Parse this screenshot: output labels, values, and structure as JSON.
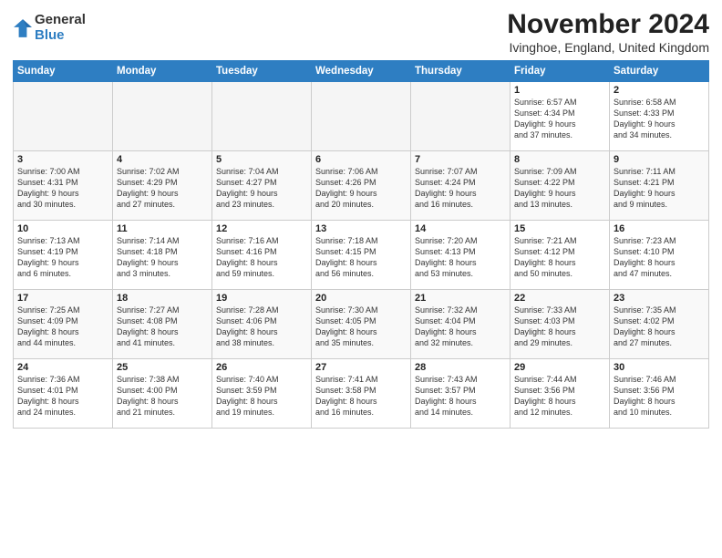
{
  "header": {
    "logo_general": "General",
    "logo_blue": "Blue",
    "month_title": "November 2024",
    "location": "Ivinghoe, England, United Kingdom"
  },
  "days_of_week": [
    "Sunday",
    "Monday",
    "Tuesday",
    "Wednesday",
    "Thursday",
    "Friday",
    "Saturday"
  ],
  "weeks": [
    [
      {
        "day": "",
        "info": ""
      },
      {
        "day": "",
        "info": ""
      },
      {
        "day": "",
        "info": ""
      },
      {
        "day": "",
        "info": ""
      },
      {
        "day": "",
        "info": ""
      },
      {
        "day": "1",
        "info": "Sunrise: 6:57 AM\nSunset: 4:34 PM\nDaylight: 9 hours\nand 37 minutes."
      },
      {
        "day": "2",
        "info": "Sunrise: 6:58 AM\nSunset: 4:33 PM\nDaylight: 9 hours\nand 34 minutes."
      }
    ],
    [
      {
        "day": "3",
        "info": "Sunrise: 7:00 AM\nSunset: 4:31 PM\nDaylight: 9 hours\nand 30 minutes."
      },
      {
        "day": "4",
        "info": "Sunrise: 7:02 AM\nSunset: 4:29 PM\nDaylight: 9 hours\nand 27 minutes."
      },
      {
        "day": "5",
        "info": "Sunrise: 7:04 AM\nSunset: 4:27 PM\nDaylight: 9 hours\nand 23 minutes."
      },
      {
        "day": "6",
        "info": "Sunrise: 7:06 AM\nSunset: 4:26 PM\nDaylight: 9 hours\nand 20 minutes."
      },
      {
        "day": "7",
        "info": "Sunrise: 7:07 AM\nSunset: 4:24 PM\nDaylight: 9 hours\nand 16 minutes."
      },
      {
        "day": "8",
        "info": "Sunrise: 7:09 AM\nSunset: 4:22 PM\nDaylight: 9 hours\nand 13 minutes."
      },
      {
        "day": "9",
        "info": "Sunrise: 7:11 AM\nSunset: 4:21 PM\nDaylight: 9 hours\nand 9 minutes."
      }
    ],
    [
      {
        "day": "10",
        "info": "Sunrise: 7:13 AM\nSunset: 4:19 PM\nDaylight: 9 hours\nand 6 minutes."
      },
      {
        "day": "11",
        "info": "Sunrise: 7:14 AM\nSunset: 4:18 PM\nDaylight: 9 hours\nand 3 minutes."
      },
      {
        "day": "12",
        "info": "Sunrise: 7:16 AM\nSunset: 4:16 PM\nDaylight: 8 hours\nand 59 minutes."
      },
      {
        "day": "13",
        "info": "Sunrise: 7:18 AM\nSunset: 4:15 PM\nDaylight: 8 hours\nand 56 minutes."
      },
      {
        "day": "14",
        "info": "Sunrise: 7:20 AM\nSunset: 4:13 PM\nDaylight: 8 hours\nand 53 minutes."
      },
      {
        "day": "15",
        "info": "Sunrise: 7:21 AM\nSunset: 4:12 PM\nDaylight: 8 hours\nand 50 minutes."
      },
      {
        "day": "16",
        "info": "Sunrise: 7:23 AM\nSunset: 4:10 PM\nDaylight: 8 hours\nand 47 minutes."
      }
    ],
    [
      {
        "day": "17",
        "info": "Sunrise: 7:25 AM\nSunset: 4:09 PM\nDaylight: 8 hours\nand 44 minutes."
      },
      {
        "day": "18",
        "info": "Sunrise: 7:27 AM\nSunset: 4:08 PM\nDaylight: 8 hours\nand 41 minutes."
      },
      {
        "day": "19",
        "info": "Sunrise: 7:28 AM\nSunset: 4:06 PM\nDaylight: 8 hours\nand 38 minutes."
      },
      {
        "day": "20",
        "info": "Sunrise: 7:30 AM\nSunset: 4:05 PM\nDaylight: 8 hours\nand 35 minutes."
      },
      {
        "day": "21",
        "info": "Sunrise: 7:32 AM\nSunset: 4:04 PM\nDaylight: 8 hours\nand 32 minutes."
      },
      {
        "day": "22",
        "info": "Sunrise: 7:33 AM\nSunset: 4:03 PM\nDaylight: 8 hours\nand 29 minutes."
      },
      {
        "day": "23",
        "info": "Sunrise: 7:35 AM\nSunset: 4:02 PM\nDaylight: 8 hours\nand 27 minutes."
      }
    ],
    [
      {
        "day": "24",
        "info": "Sunrise: 7:36 AM\nSunset: 4:01 PM\nDaylight: 8 hours\nand 24 minutes."
      },
      {
        "day": "25",
        "info": "Sunrise: 7:38 AM\nSunset: 4:00 PM\nDaylight: 8 hours\nand 21 minutes."
      },
      {
        "day": "26",
        "info": "Sunrise: 7:40 AM\nSunset: 3:59 PM\nDaylight: 8 hours\nand 19 minutes."
      },
      {
        "day": "27",
        "info": "Sunrise: 7:41 AM\nSunset: 3:58 PM\nDaylight: 8 hours\nand 16 minutes."
      },
      {
        "day": "28",
        "info": "Sunrise: 7:43 AM\nSunset: 3:57 PM\nDaylight: 8 hours\nand 14 minutes."
      },
      {
        "day": "29",
        "info": "Sunrise: 7:44 AM\nSunset: 3:56 PM\nDaylight: 8 hours\nand 12 minutes."
      },
      {
        "day": "30",
        "info": "Sunrise: 7:46 AM\nSunset: 3:56 PM\nDaylight: 8 hours\nand 10 minutes."
      }
    ]
  ]
}
